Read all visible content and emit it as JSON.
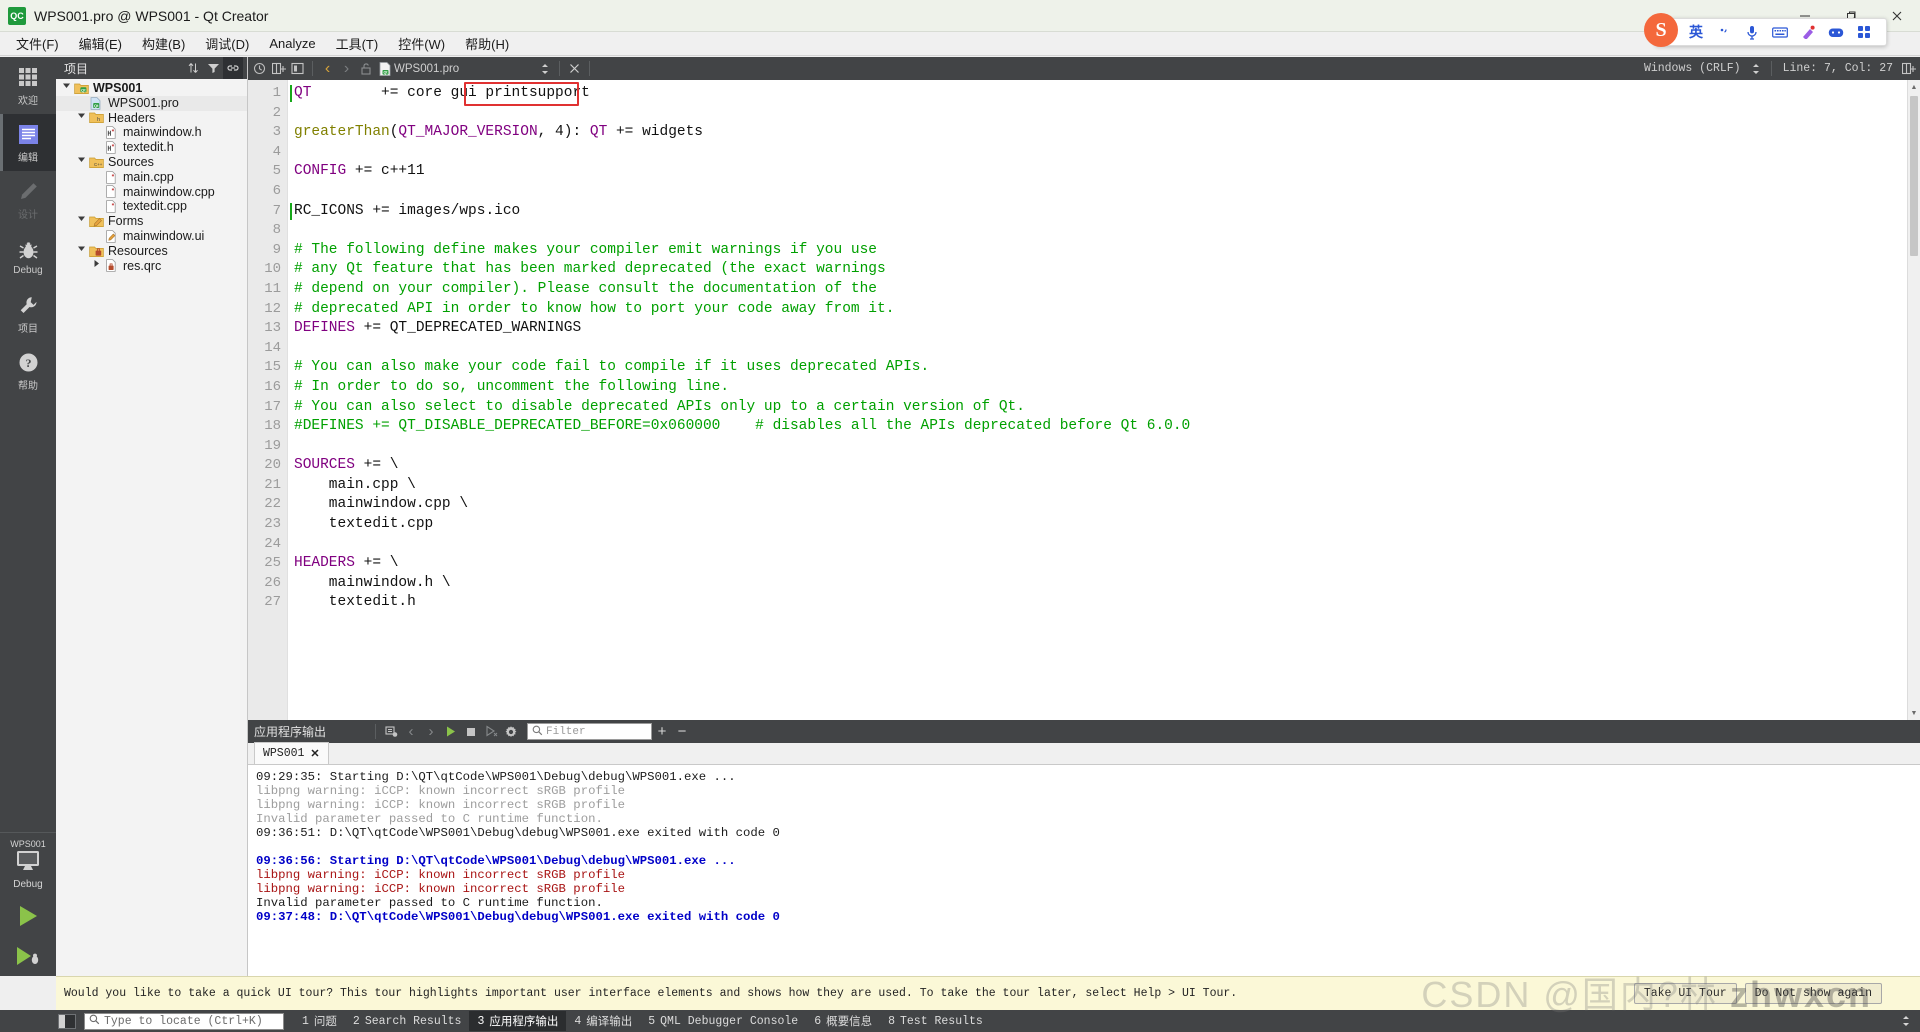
{
  "window": {
    "title": "WPS001.pro @ WPS001 - Qt Creator",
    "app_icon": "qt-creator-icon",
    "minimize": "—",
    "maximize": "❐",
    "close": "✕"
  },
  "menubar": {
    "items": [
      {
        "label": "文件(F)",
        "name": "menu-file"
      },
      {
        "label": "编辑(E)",
        "name": "menu-edit"
      },
      {
        "label": "构建(B)",
        "name": "menu-build"
      },
      {
        "label": "调试(D)",
        "name": "menu-debug"
      },
      {
        "label": "Analyze",
        "name": "menu-analyze"
      },
      {
        "label": "工具(T)",
        "name": "menu-tools"
      },
      {
        "label": "控件(W)",
        "name": "menu-window"
      },
      {
        "label": "帮助(H)",
        "name": "menu-help"
      }
    ]
  },
  "modebar": {
    "modes": [
      {
        "label": "欢迎",
        "icon": "grid-icon",
        "state": "normal"
      },
      {
        "label": "编辑",
        "icon": "document-lines-icon",
        "state": "active"
      },
      {
        "label": "设计",
        "icon": "pencil-icon",
        "state": "disabled"
      },
      {
        "label": "Debug",
        "icon": "bug-icon",
        "state": "normal"
      },
      {
        "label": "项目",
        "icon": "wrench-icon",
        "state": "normal"
      },
      {
        "label": "帮助",
        "icon": "question-circle-icon",
        "state": "normal"
      }
    ],
    "kit": {
      "project": "WPS001",
      "build_config": "Debug",
      "icon": "monitor-icon"
    },
    "run_button": "run-triangle-icon",
    "debug_button": "run-debug-icon"
  },
  "project_pane": {
    "title": "项目",
    "buttons": [
      {
        "name": "sort-toggle-icon",
        "glyph": "⇵"
      },
      {
        "name": "filter-icon",
        "glyph": "▼"
      },
      {
        "name": "link-with-editor-icon",
        "glyph": "⚭"
      }
    ],
    "tree": [
      {
        "label": "WPS001",
        "depth": 0,
        "arrow": "down",
        "icon": "qt-project-folder-icon",
        "bold": true,
        "selected": false
      },
      {
        "label": "WPS001.pro",
        "depth": 1,
        "arrow": "none",
        "icon": "qt-pro-file-icon",
        "bold": false,
        "selected": true
      },
      {
        "label": "Headers",
        "depth": 1,
        "arrow": "down",
        "icon": "headers-folder-icon",
        "bold": false,
        "selected": false
      },
      {
        "label": "mainwindow.h",
        "depth": 2,
        "arrow": "none",
        "icon": "header-file-icon",
        "bold": false,
        "selected": false
      },
      {
        "label": "textedit.h",
        "depth": 2,
        "arrow": "none",
        "icon": "header-file-icon",
        "bold": false,
        "selected": false
      },
      {
        "label": "Sources",
        "depth": 1,
        "arrow": "down",
        "icon": "sources-folder-icon",
        "bold": false,
        "selected": false
      },
      {
        "label": "main.cpp",
        "depth": 2,
        "arrow": "none",
        "icon": "cpp-file-icon",
        "bold": false,
        "selected": false
      },
      {
        "label": "mainwindow.cpp",
        "depth": 2,
        "arrow": "none",
        "icon": "cpp-file-icon",
        "bold": false,
        "selected": false
      },
      {
        "label": "textedit.cpp",
        "depth": 2,
        "arrow": "none",
        "icon": "cpp-file-icon",
        "bold": false,
        "selected": false
      },
      {
        "label": "Forms",
        "depth": 1,
        "arrow": "down",
        "icon": "forms-folder-icon",
        "bold": false,
        "selected": false
      },
      {
        "label": "mainwindow.ui",
        "depth": 2,
        "arrow": "none",
        "icon": "ui-file-icon",
        "bold": false,
        "selected": false
      },
      {
        "label": "Resources",
        "depth": 1,
        "arrow": "down",
        "icon": "resources-folder-icon",
        "bold": false,
        "selected": false
      },
      {
        "label": "res.qrc",
        "depth": 2,
        "arrow": "right",
        "icon": "qrc-file-icon",
        "bold": false,
        "selected": false
      }
    ]
  },
  "editor_toolbar": {
    "left_buttons": [
      {
        "name": "split-editor-icon",
        "glyph": "⊞"
      },
      {
        "name": "add-split-icon",
        "glyph": "▣"
      }
    ],
    "nav_back": "‹",
    "nav_forward": "›",
    "lock_icon": "unlocked-icon",
    "file_icon": "qt-pro-file-icon",
    "file_name": "WPS001.pro",
    "dropdown_icon": "⇅",
    "close_icon": "✕",
    "line_ending": "Windows (CRLF)",
    "encoding_dropdown_icon": "⇅",
    "cursor_position": "Line: 7, Col: 27",
    "split_icon": "⊞"
  },
  "code": {
    "highlight_box": {
      "text": "printsupport",
      "color": "#e03131"
    },
    "caret_lines": [
      1,
      7
    ],
    "lines": [
      {
        "n": 1,
        "tokens": [
          {
            "t": "QT",
            "c": "kw"
          },
          {
            "t": "        += core gui printsupport",
            "c": "pl"
          }
        ]
      },
      {
        "n": 2,
        "tokens": [
          {
            "t": "",
            "c": "pl"
          }
        ]
      },
      {
        "n": 3,
        "tokens": [
          {
            "t": "greaterThan",
            "c": "fn"
          },
          {
            "t": "(",
            "c": "pl"
          },
          {
            "t": "QT_MAJOR_VERSION",
            "c": "kw"
          },
          {
            "t": ", 4): ",
            "c": "pl"
          },
          {
            "t": "QT",
            "c": "kw"
          },
          {
            "t": " += widgets",
            "c": "pl"
          }
        ]
      },
      {
        "n": 4,
        "tokens": [
          {
            "t": "",
            "c": "pl"
          }
        ]
      },
      {
        "n": 5,
        "tokens": [
          {
            "t": "CONFIG",
            "c": "kw"
          },
          {
            "t": " += c++11",
            "c": "pl"
          }
        ]
      },
      {
        "n": 6,
        "tokens": [
          {
            "t": "",
            "c": "pl"
          }
        ]
      },
      {
        "n": 7,
        "tokens": [
          {
            "t": "RC_ICONS",
            "c": "pl"
          },
          {
            "t": " += images/wps.ico",
            "c": "pl"
          }
        ]
      },
      {
        "n": 8,
        "tokens": [
          {
            "t": "",
            "c": "pl"
          }
        ]
      },
      {
        "n": 9,
        "tokens": [
          {
            "t": "# The following define makes your compiler emit warnings if you use",
            "c": "cm"
          }
        ]
      },
      {
        "n": 10,
        "tokens": [
          {
            "t": "# any Qt feature that has been marked deprecated (the exact warnings",
            "c": "cm"
          }
        ]
      },
      {
        "n": 11,
        "tokens": [
          {
            "t": "# depend on your compiler). Please consult the documentation of the",
            "c": "cm"
          }
        ]
      },
      {
        "n": 12,
        "tokens": [
          {
            "t": "# deprecated API in order to know how to port your code away from it.",
            "c": "cm"
          }
        ]
      },
      {
        "n": 13,
        "tokens": [
          {
            "t": "DEFINES",
            "c": "kw"
          },
          {
            "t": " += QT_DEPRECATED_WARNINGS",
            "c": "pl"
          }
        ]
      },
      {
        "n": 14,
        "tokens": [
          {
            "t": "",
            "c": "pl"
          }
        ]
      },
      {
        "n": 15,
        "tokens": [
          {
            "t": "# You can also make your code fail to compile if it uses deprecated APIs.",
            "c": "cm"
          }
        ]
      },
      {
        "n": 16,
        "tokens": [
          {
            "t": "# In order to do so, uncomment the following line.",
            "c": "cm"
          }
        ]
      },
      {
        "n": 17,
        "tokens": [
          {
            "t": "# You can also select to disable deprecated APIs only up to a certain version of Qt.",
            "c": "cm"
          }
        ]
      },
      {
        "n": 18,
        "tokens": [
          {
            "t": "#DEFINES += QT_DISABLE_DEPRECATED_BEFORE=0x060000    # disables all the APIs deprecated before Qt 6.0.0",
            "c": "cm"
          }
        ]
      },
      {
        "n": 19,
        "tokens": [
          {
            "t": "",
            "c": "pl"
          }
        ]
      },
      {
        "n": 20,
        "tokens": [
          {
            "t": "SOURCES",
            "c": "kw"
          },
          {
            "t": " += \\",
            "c": "pl"
          }
        ]
      },
      {
        "n": 21,
        "tokens": [
          {
            "t": "    main.cpp \\",
            "c": "pl"
          }
        ]
      },
      {
        "n": 22,
        "tokens": [
          {
            "t": "    mainwindow.cpp \\",
            "c": "pl"
          }
        ]
      },
      {
        "n": 23,
        "tokens": [
          {
            "t": "    textedit.cpp",
            "c": "pl"
          }
        ]
      },
      {
        "n": 24,
        "tokens": [
          {
            "t": "",
            "c": "pl"
          }
        ]
      },
      {
        "n": 25,
        "tokens": [
          {
            "t": "HEADERS",
            "c": "kw"
          },
          {
            "t": " += \\",
            "c": "pl"
          }
        ]
      },
      {
        "n": 26,
        "tokens": [
          {
            "t": "    mainwindow.h \\",
            "c": "pl"
          }
        ]
      },
      {
        "n": 27,
        "tokens": [
          {
            "t": "    textedit.h",
            "c": "pl"
          }
        ]
      }
    ]
  },
  "output_pane": {
    "title": "应用程序输出",
    "buttons": [
      {
        "name": "attach-to-output-icon",
        "glyph": "⎙"
      },
      {
        "name": "prev-item-icon",
        "glyph": "‹"
      },
      {
        "name": "next-item-icon",
        "glyph": "›"
      },
      {
        "name": "run-icon",
        "glyph": "▶"
      },
      {
        "name": "stop-icon",
        "glyph": "■"
      },
      {
        "name": "rerun-icon",
        "glyph": "▷"
      },
      {
        "name": "settings-gear-icon",
        "glyph": "⚙"
      }
    ],
    "filter_placeholder": "Filter",
    "filter_value": "",
    "search_icon": "search-icon",
    "zoom_in": "+",
    "zoom_out": "−",
    "tab": {
      "label": "WPS001",
      "close_glyph": "✕"
    },
    "log": [
      {
        "text": "09:29:35: Starting D:\\QT\\qtCode\\WPS001\\Debug\\debug\\WPS001.exe ...",
        "style": "o-dark"
      },
      {
        "text": "libpng warning: iCCP: known incorrect sRGB profile",
        "style": "o-gray"
      },
      {
        "text": "libpng warning: iCCP: known incorrect sRGB profile",
        "style": "o-gray"
      },
      {
        "text": "Invalid parameter passed to C runtime function.",
        "style": "o-gray"
      },
      {
        "text": "09:36:51: D:\\QT\\qtCode\\WPS001\\Debug\\debug\\WPS001.exe exited with code 0",
        "style": "o-dark"
      },
      {
        "text": "",
        "style": "o-blank"
      },
      {
        "text": "09:36:56: Starting D:\\QT\\qtCode\\WPS001\\Debug\\debug\\WPS001.exe ...",
        "style": "o-blue"
      },
      {
        "text": "libpng warning: iCCP: known incorrect sRGB profile",
        "style": "o-red"
      },
      {
        "text": "libpng warning: iCCP: known incorrect sRGB profile",
        "style": "o-red"
      },
      {
        "text": "Invalid parameter passed to C runtime function.",
        "style": "o-dark"
      },
      {
        "text": "09:37:48: D:\\QT\\qtCode\\WPS001\\Debug\\debug\\WPS001.exe exited with code 0",
        "style": "o-blue"
      }
    ]
  },
  "tour_bar": {
    "message": "Would you like to take a quick UI tour? This tour highlights important user interface elements and shows how they are used. To take the tour later, select Help > UI Tour.",
    "take_tour": "Take UI Tour",
    "do_not_show": "Do Not show again"
  },
  "status_bar": {
    "locator_placeholder": "Type to locate (Ctrl+K)",
    "locator_value": "",
    "search_icon": "search-icon",
    "toggle_sidebar_icon": "toggle-sidebar-icon",
    "items": [
      {
        "num": "1",
        "label": "问题",
        "active": false
      },
      {
        "num": "2",
        "label": "Search Results",
        "active": false
      },
      {
        "num": "3",
        "label": "应用程序输出",
        "active": true
      },
      {
        "num": "4",
        "label": "编译输出",
        "active": false
      },
      {
        "num": "5",
        "label": "QML Debugger Console",
        "active": false
      },
      {
        "num": "6",
        "label": "概要信息",
        "active": false
      },
      {
        "num": "8",
        "label": "Test Results",
        "active": false
      }
    ],
    "more_icon": "⇅"
  },
  "ime": {
    "logo": "S",
    "items": [
      {
        "name": "ime-mode-english",
        "glyph": "英"
      },
      {
        "name": "ime-punctuation-icon",
        "glyph": "˙,"
      },
      {
        "name": "ime-voice-icon",
        "glyph": "Ἲ4"
      },
      {
        "name": "ime-keyboard-icon",
        "glyph": "⌨"
      },
      {
        "name": "ime-color-icon",
        "glyph": "✦"
      },
      {
        "name": "ime-emoji-icon",
        "glyph": "☺"
      },
      {
        "name": "ime-apps-icon",
        "glyph": "☰"
      }
    ]
  },
  "watermark": {
    "text": "CSDN @国内?林",
    "bold_text": "zhwxcn"
  }
}
